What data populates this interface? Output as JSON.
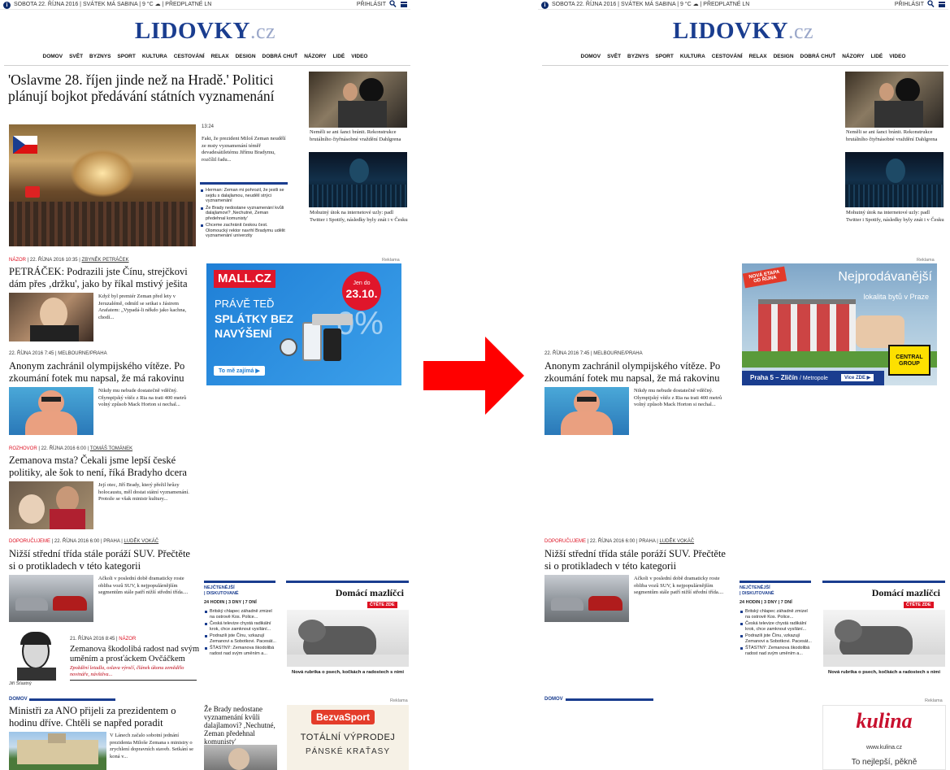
{
  "topbar": {
    "info_glyph": "i",
    "date": "SOBOTA 22. ŘÍJNA 2016 | SVÁTEK MÁ SABINA | 9 °C ☁ | PŘEDPLATNÉ LN",
    "login": "PŘIHLÁSIT",
    "icons": [
      "info-icon",
      "search-icon",
      "menu-icon"
    ]
  },
  "logo": {
    "main": "LIDOVKY",
    "suffix": ".cz"
  },
  "nav": [
    "DOMOV",
    "SVĚT",
    "BYZNYS",
    "SPORT",
    "KULTURA",
    "CESTOVÁNÍ",
    "RELAX",
    "DESIGN",
    "DOBRÁ CHUŤ",
    "NÁZORY",
    "LIDÉ",
    "VIDEO"
  ],
  "lead": {
    "title": "'Oslavme 28. říjen jinde než na Hradě.' Politici plánují bojkot předávání státních vyznamenání",
    "time": "13:24",
    "perex": "Fakt, že prezident Miloš Zeman neudělí ze msty vyznamenání téměř devadesátiletému Jiřímu Bradymu, rozčílil řadu...",
    "related": [
      "Herman: Zeman mi pohrozil, že jestli se sejdu s dalajlamou, neudělí strýci vyznamenání",
      "Že Brady nedostane vyznamenání kvůli dalajlamovi? ,Nechutné, Zeman předehnal komunisty'",
      "Chceme zachránit českou čest. Olomoucký rektor navrhl Bradymu udělit vyznamenání univerzity"
    ]
  },
  "side": [
    {
      "text": "Neměli se ani šanci bránit. Rekonstrukce brutálního čtyřnásobné vraždění Dahlgrena"
    },
    {
      "text": "Mohutný útok na internetové uzly: padl Twitter i Spotify, následky byly znát i v Česku"
    }
  ],
  "petracek": {
    "tag": "NÁZOR",
    "date": "22. ŘÍJNA 2016 10:35",
    "author": "ZBYNĚK PETRÁČEK",
    "title": "PETRÁČEK: Podrazili jste Čínu, strejčkovi dám přes ‚držku', jako by říkal mstivý ješita",
    "perex": "Když byl premiér Zeman před lety v Jeruzalémě, odmítl se setkat s Jásirem Arafatem: „Vypadá-li někdo jako kachna, chodí..."
  },
  "ad1": {
    "label": "Reklama",
    "brand": "MALL.CZ",
    "badge_top": "Jen do",
    "badge_date": "23.10.",
    "line1": "PRÁVĚ TEĎ",
    "line2": "SPLÁTKY BEZ",
    "line3": "NAVÝŠENÍ",
    "cta": "To mě zajímá ▶",
    "pct": "0%"
  },
  "ad2": {
    "label": "Reklama",
    "banner_tag": "NOVÁ ETAPA OD ŘÍJNA",
    "title": "Nejprodávanější",
    "subtitle": "lokalita bytů v Praze",
    "location": "Praha 5 – Zličín",
    "metro": "/ Metropole",
    "cta": "Více ZDE ▶",
    "brand": "CENTRAL GROUP"
  },
  "olymp": {
    "meta": "22. ŘÍJNA 2016 7:45 | MELBOURNE/PRAHA",
    "title": "Anonym zachránil olympijského vítěze. Po zkoumání fotek mu napsal, že má rakovinu",
    "perex": "Nikdy mu nebude dostatečně vděčný. Olympijský vítěz z Ria na trati 400 metrů volný způsob Mack Horton si nechal..."
  },
  "brady": {
    "tag": "ROZHOVOR",
    "date": "22. ŘÍJNA 2016 6:00",
    "author": "TOMÁŠ TOMÁNEK",
    "title": "Zemanova msta? Čekali jsme lepší české politiky, ale šok to není, říká Bradyho dcera",
    "perex": "Její otec, Jiří Brady, který přežil hrůzy holocaustu, měl dostat státní vyznamenání. Protože se však ministr kultury..."
  },
  "suv": {
    "tag": "DOPORUČUJEME",
    "date": "22. ŘÍJNA 2016 6:00",
    "place": "PRAHA",
    "author": "LUDĚK VOKÁČ",
    "title": "Nižší střední třída stále poráží SUV. Přečtěte si o protikladech v této kategorii",
    "perex": "Ačkoli v poslední době dramaticky roste obliba vozů SUV, k nejpopulárnějším segmentům stále patří nižší střední třída...."
  },
  "most_read": {
    "title": "NEJČTENĚJŠÍ",
    "subtitle": "| DISKUTOVANÉ",
    "tabs": "24 HODIN | 3 DNY | 7 DNÍ",
    "items": [
      "Britský chlapec záhadně zmizel na ostrově Kos. Police...",
      "Česká televize chystá radikální krok, chce zamknout vysílání...",
      "Podrazili jste Čínu, vzkazují Zemanovi a Sobotkovi. Pacesát...",
      "ŠŤASTNÝ: Zemanova škodolibá radost nad svým uměním a..."
    ]
  },
  "pets": {
    "title": "Domácí mazlíčci",
    "cta": "ČTĚTE ZDE",
    "caption": "Nová rubrika o psech, kočkách a radostech s nimi"
  },
  "stastny": {
    "date": "21. ŘÍJNA 2016 8:45",
    "tag": "NÁZOR",
    "title": "Zemanova škodolibá radost nad svým uměním a prosťáckem Ovčáčkem",
    "perex": "Zpoždění letadla, oslava výročí, článek úkonu zemědělo novináře, návštěva...",
    "author": "Jiří Šťastný"
  },
  "domov": {
    "tag": "DOMOV",
    "title": "Ministři za ANO přijeli za prezidentem o hodinu dříve. Chtěli se napřed poradit",
    "perex": "V Lánech začalo sobotní jednání prezidenta Miloše Zemana s ministry o zrychlení dopravních staveb. Setkání se koná v...",
    "side": "Že Brady nedostane vyznamenání kvůli dalajlamovi? ,Nechutné, Zeman předehnal komunisty'"
  },
  "ad3": {
    "label": "Reklama",
    "brand": "BezvaSport",
    "line1": "TOTÁLNÍ VÝPRODEJ",
    "line2": "PÁNSKÉ KRAŤASY"
  },
  "ad4": {
    "label": "Reklama",
    "brand": "kulina",
    "url": "www.kulina.cz",
    "line1": "To nejlepší, pěkně"
  },
  "colors": {
    "accent": "#1a3d8f",
    "red": "#d12",
    "arrow": "#f00"
  }
}
